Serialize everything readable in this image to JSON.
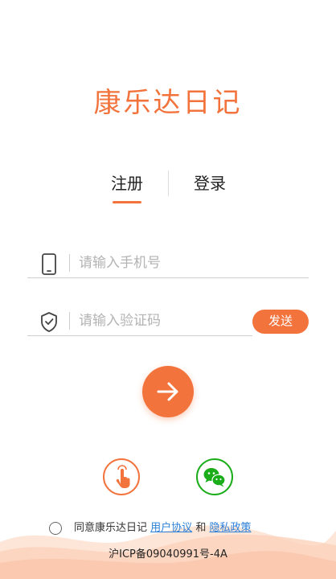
{
  "app": {
    "logo_text": "康乐达日记"
  },
  "tabs": {
    "register": "注册",
    "login": "登录"
  },
  "form": {
    "phone_placeholder": "请输入手机号",
    "code_placeholder": "请输入验证码",
    "send_label": "发送"
  },
  "icons": {
    "phone": "phone-icon",
    "shield": "shield-check-icon",
    "arrow": "arrow-right-icon",
    "touch": "touch-login-icon",
    "wechat": "wechat-icon"
  },
  "agreement": {
    "prefix": "同意康乐达日记",
    "user_agreement": "用户协议",
    "conjunction": "和",
    "privacy_policy": "隐私政策"
  },
  "footer": {
    "icp": "沪ICP备09040991号-4A"
  },
  "colors": {
    "accent": "#f3733c",
    "wechat": "#1aad19",
    "link": "#2b7fd8"
  }
}
